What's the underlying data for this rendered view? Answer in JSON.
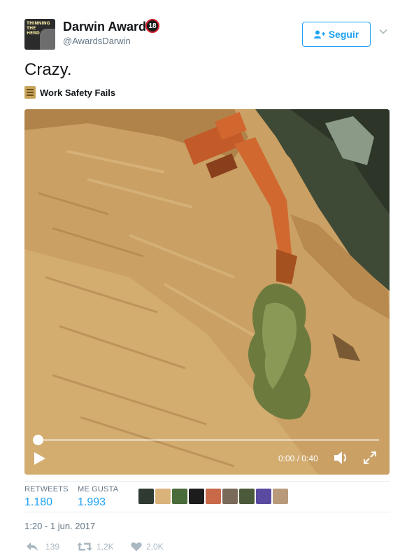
{
  "header": {
    "avatar_text": "THINNING THE HERD",
    "display_name": "Darwin Award",
    "age_badge": "18",
    "handle": "@AwardsDarwin",
    "follow_label": "Seguir"
  },
  "tweet": {
    "text": "Crazy.",
    "card_label": "Work Safety Fails"
  },
  "video": {
    "time_display": "0:00 / 0:40",
    "progress": 0.0
  },
  "stats": {
    "retweets_label": "RETWEETS",
    "retweets_value": "1.180",
    "likes_label": "ME GUSTA",
    "likes_value": "1.993",
    "liker_colors": [
      "#2f3a32",
      "#d9b37a",
      "#4a6b3a",
      "#1c1c1c",
      "#c86a4a",
      "#7a6a5a",
      "#4b5a3a",
      "#5a4aa0",
      "#b89a7a"
    ]
  },
  "timestamp": "1:20 - 1 jun. 2017",
  "actions": {
    "replies": "139",
    "retweets": "1,2K",
    "likes": "2,0K"
  },
  "colors": {
    "accent": "#1da1f2",
    "muted": "#657786",
    "icon_muted": "#aab8c2"
  }
}
